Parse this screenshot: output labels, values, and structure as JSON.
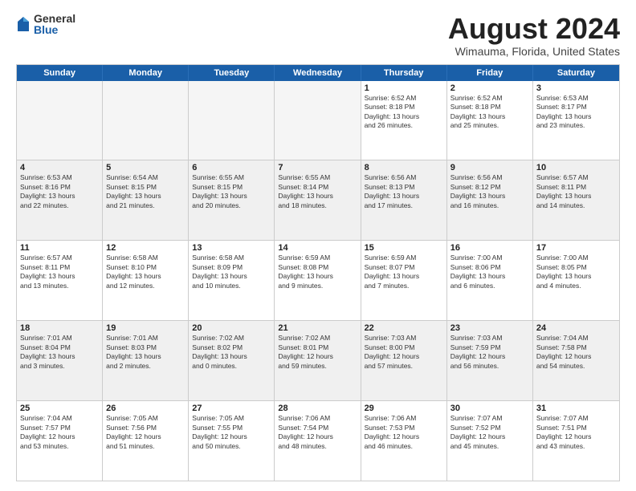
{
  "logo": {
    "general": "General",
    "blue": "Blue"
  },
  "title": "August 2024",
  "subtitle": "Wimauma, Florida, United States",
  "weekdays": [
    "Sunday",
    "Monday",
    "Tuesday",
    "Wednesday",
    "Thursday",
    "Friday",
    "Saturday"
  ],
  "rows": [
    [
      {
        "day": "",
        "text": "",
        "empty": true
      },
      {
        "day": "",
        "text": "",
        "empty": true
      },
      {
        "day": "",
        "text": "",
        "empty": true
      },
      {
        "day": "",
        "text": "",
        "empty": true
      },
      {
        "day": "1",
        "text": "Sunrise: 6:52 AM\nSunset: 8:18 PM\nDaylight: 13 hours\nand 26 minutes."
      },
      {
        "day": "2",
        "text": "Sunrise: 6:52 AM\nSunset: 8:18 PM\nDaylight: 13 hours\nand 25 minutes."
      },
      {
        "day": "3",
        "text": "Sunrise: 6:53 AM\nSunset: 8:17 PM\nDaylight: 13 hours\nand 23 minutes."
      }
    ],
    [
      {
        "day": "4",
        "text": "Sunrise: 6:53 AM\nSunset: 8:16 PM\nDaylight: 13 hours\nand 22 minutes."
      },
      {
        "day": "5",
        "text": "Sunrise: 6:54 AM\nSunset: 8:15 PM\nDaylight: 13 hours\nand 21 minutes."
      },
      {
        "day": "6",
        "text": "Sunrise: 6:55 AM\nSunset: 8:15 PM\nDaylight: 13 hours\nand 20 minutes."
      },
      {
        "day": "7",
        "text": "Sunrise: 6:55 AM\nSunset: 8:14 PM\nDaylight: 13 hours\nand 18 minutes."
      },
      {
        "day": "8",
        "text": "Sunrise: 6:56 AM\nSunset: 8:13 PM\nDaylight: 13 hours\nand 17 minutes."
      },
      {
        "day": "9",
        "text": "Sunrise: 6:56 AM\nSunset: 8:12 PM\nDaylight: 13 hours\nand 16 minutes."
      },
      {
        "day": "10",
        "text": "Sunrise: 6:57 AM\nSunset: 8:11 PM\nDaylight: 13 hours\nand 14 minutes."
      }
    ],
    [
      {
        "day": "11",
        "text": "Sunrise: 6:57 AM\nSunset: 8:11 PM\nDaylight: 13 hours\nand 13 minutes."
      },
      {
        "day": "12",
        "text": "Sunrise: 6:58 AM\nSunset: 8:10 PM\nDaylight: 13 hours\nand 12 minutes."
      },
      {
        "day": "13",
        "text": "Sunrise: 6:58 AM\nSunset: 8:09 PM\nDaylight: 13 hours\nand 10 minutes."
      },
      {
        "day": "14",
        "text": "Sunrise: 6:59 AM\nSunset: 8:08 PM\nDaylight: 13 hours\nand 9 minutes."
      },
      {
        "day": "15",
        "text": "Sunrise: 6:59 AM\nSunset: 8:07 PM\nDaylight: 13 hours\nand 7 minutes."
      },
      {
        "day": "16",
        "text": "Sunrise: 7:00 AM\nSunset: 8:06 PM\nDaylight: 13 hours\nand 6 minutes."
      },
      {
        "day": "17",
        "text": "Sunrise: 7:00 AM\nSunset: 8:05 PM\nDaylight: 13 hours\nand 4 minutes."
      }
    ],
    [
      {
        "day": "18",
        "text": "Sunrise: 7:01 AM\nSunset: 8:04 PM\nDaylight: 13 hours\nand 3 minutes."
      },
      {
        "day": "19",
        "text": "Sunrise: 7:01 AM\nSunset: 8:03 PM\nDaylight: 13 hours\nand 2 minutes."
      },
      {
        "day": "20",
        "text": "Sunrise: 7:02 AM\nSunset: 8:02 PM\nDaylight: 13 hours\nand 0 minutes."
      },
      {
        "day": "21",
        "text": "Sunrise: 7:02 AM\nSunset: 8:01 PM\nDaylight: 12 hours\nand 59 minutes."
      },
      {
        "day": "22",
        "text": "Sunrise: 7:03 AM\nSunset: 8:00 PM\nDaylight: 12 hours\nand 57 minutes."
      },
      {
        "day": "23",
        "text": "Sunrise: 7:03 AM\nSunset: 7:59 PM\nDaylight: 12 hours\nand 56 minutes."
      },
      {
        "day": "24",
        "text": "Sunrise: 7:04 AM\nSunset: 7:58 PM\nDaylight: 12 hours\nand 54 minutes."
      }
    ],
    [
      {
        "day": "25",
        "text": "Sunrise: 7:04 AM\nSunset: 7:57 PM\nDaylight: 12 hours\nand 53 minutes."
      },
      {
        "day": "26",
        "text": "Sunrise: 7:05 AM\nSunset: 7:56 PM\nDaylight: 12 hours\nand 51 minutes."
      },
      {
        "day": "27",
        "text": "Sunrise: 7:05 AM\nSunset: 7:55 PM\nDaylight: 12 hours\nand 50 minutes."
      },
      {
        "day": "28",
        "text": "Sunrise: 7:06 AM\nSunset: 7:54 PM\nDaylight: 12 hours\nand 48 minutes."
      },
      {
        "day": "29",
        "text": "Sunrise: 7:06 AM\nSunset: 7:53 PM\nDaylight: 12 hours\nand 46 minutes."
      },
      {
        "day": "30",
        "text": "Sunrise: 7:07 AM\nSunset: 7:52 PM\nDaylight: 12 hours\nand 45 minutes."
      },
      {
        "day": "31",
        "text": "Sunrise: 7:07 AM\nSunset: 7:51 PM\nDaylight: 12 hours\nand 43 minutes."
      }
    ]
  ]
}
